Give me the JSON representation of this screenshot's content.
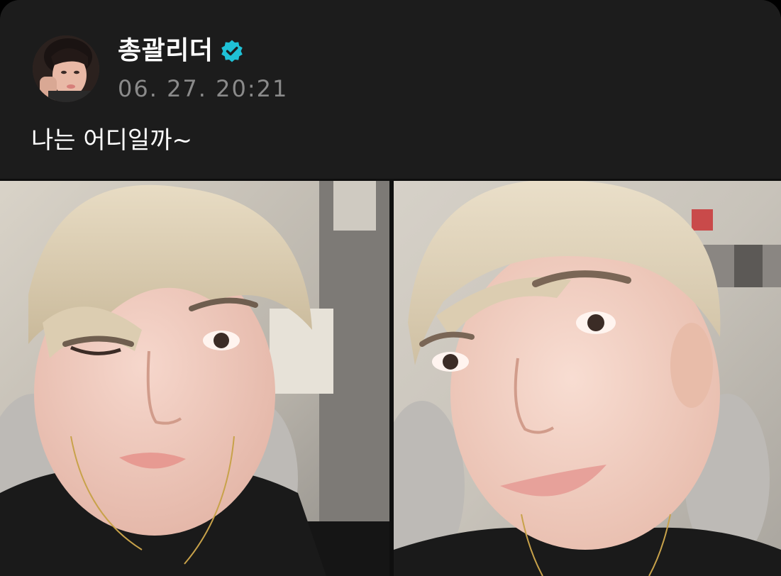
{
  "post": {
    "author_name": "총괄리더",
    "timestamp": "06. 27. 20:21",
    "text": "나는 어디일까~",
    "verified": true
  },
  "icons": {
    "avatar": "profile-avatar",
    "verified": "verified-badge-icon"
  },
  "photos": [
    {
      "name": "selfie-photo-1",
      "description_visible": false
    },
    {
      "name": "selfie-photo-2",
      "description_visible": false
    }
  ],
  "colors": {
    "background": "#1c1c1c",
    "text_primary": "#ffffff",
    "text_secondary": "#8a8a8a",
    "verified_badge": "#1fc1d6"
  }
}
